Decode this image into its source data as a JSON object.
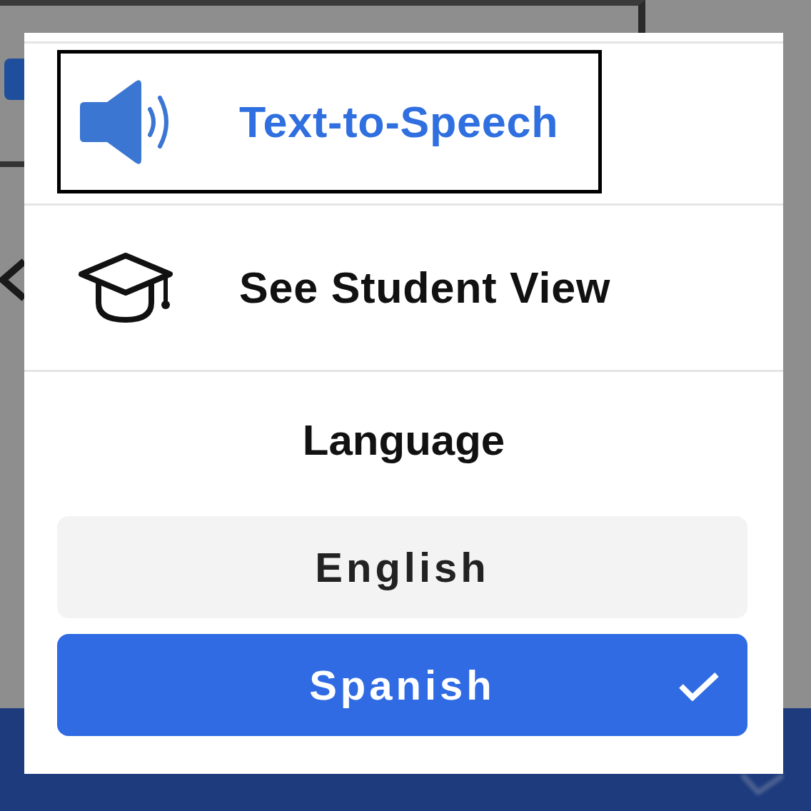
{
  "menu": {
    "items": [
      {
        "kind": "speech",
        "label": "Text-to-Speech",
        "focused": true
      },
      {
        "kind": "student_view",
        "label": "See Student View",
        "focused": false
      }
    ]
  },
  "language": {
    "heading": "Language",
    "options": [
      {
        "label": "English",
        "selected": false
      },
      {
        "label": "Spanish",
        "selected": true
      }
    ]
  }
}
